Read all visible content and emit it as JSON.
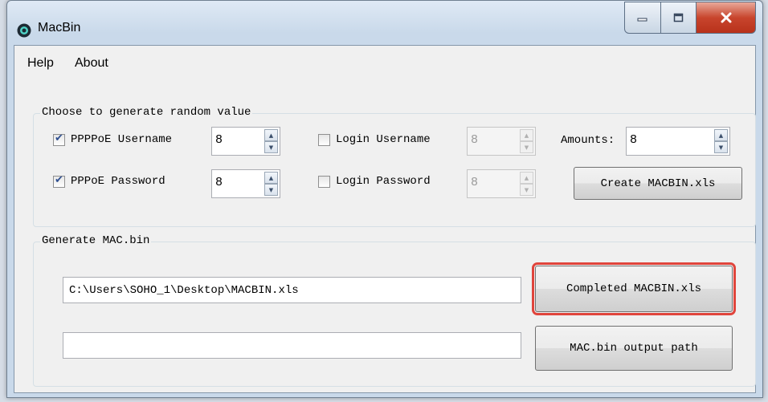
{
  "window": {
    "title": "MacBin",
    "controls": {
      "minimize_icon": "minimize-icon",
      "maximize_icon": "maximize-icon",
      "close_icon": "close-icon"
    }
  },
  "menu": {
    "help": "Help",
    "about": "About"
  },
  "random_group": {
    "title": "Choose to generate random value",
    "pppoe_username": {
      "label": "PPPPoE Username",
      "checked": true,
      "value": "8"
    },
    "pppoe_password": {
      "label": "PPPoE Password",
      "checked": true,
      "value": "8"
    },
    "login_username": {
      "label": "Login Username",
      "checked": false,
      "value": "8"
    },
    "login_password": {
      "label": "Login Password",
      "checked": false,
      "value": "8"
    },
    "amounts": {
      "label": "Amounts:",
      "value": "8"
    },
    "create_button": "Create MACBIN.xls"
  },
  "mac_group": {
    "title": "Generate MAC.bin",
    "xls_path": "C:\\Users\\SOHO_1\\Desktop\\MACBIN.xls",
    "completed_button": "Completed MACBIN.xls",
    "output_path": "",
    "output_button": "MAC.bin output path"
  },
  "colors": {
    "highlight": "#e0453c",
    "close_button": "#c8452d"
  }
}
